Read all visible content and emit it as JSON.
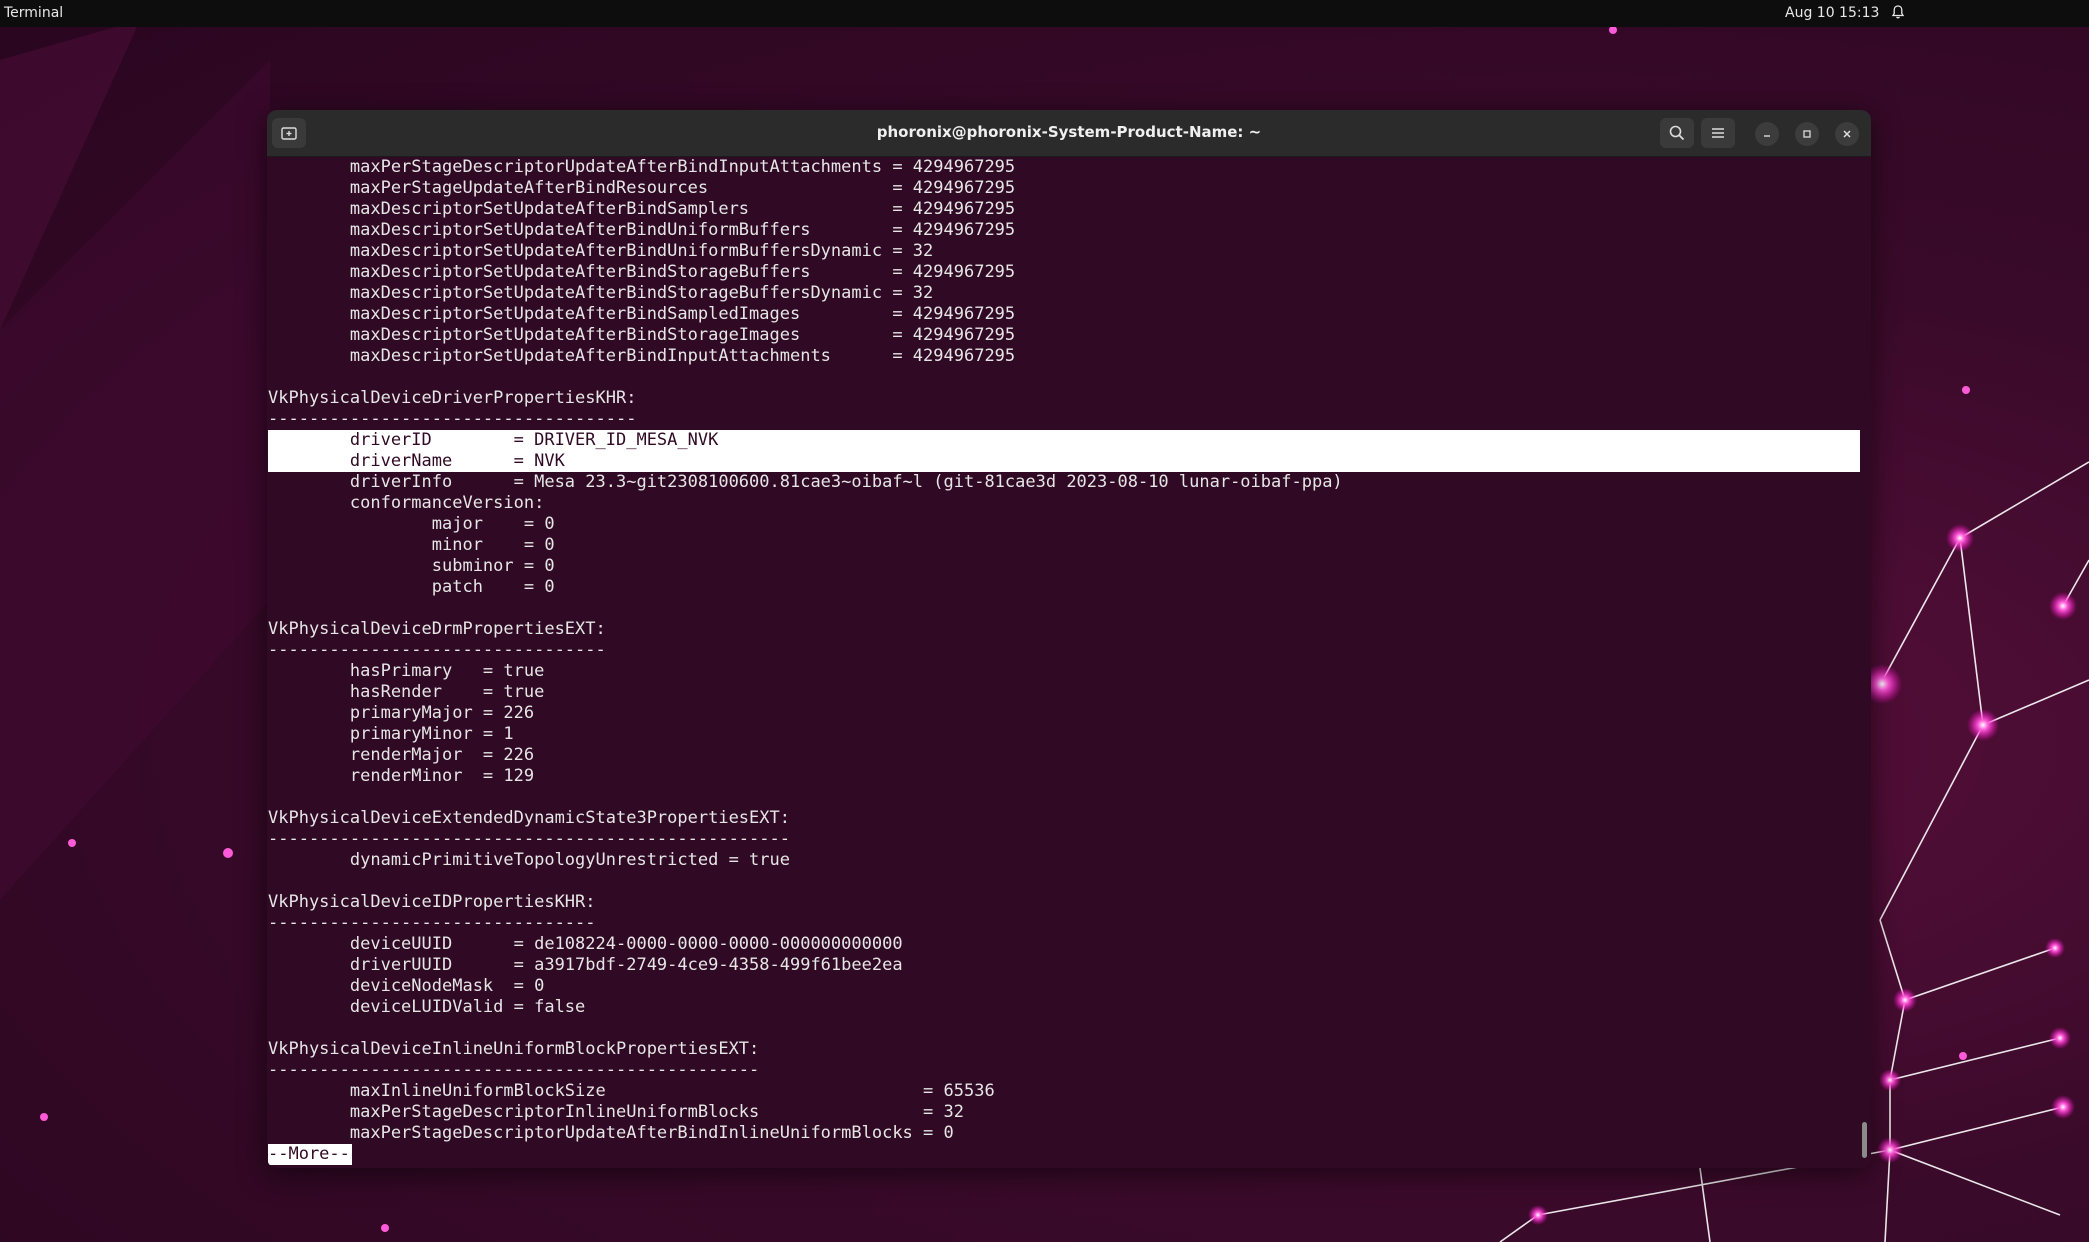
{
  "topbar": {
    "app_name": "Terminal",
    "datetime": "Aug 10  15:13",
    "bell_icon": "notification-bell-icon"
  },
  "window": {
    "title": "phoronix@phoronix-System-Product-Name: ~",
    "buttons": {
      "new_tab": "new-tab-icon",
      "search": "search-icon",
      "menu": "hamburger-menu-icon",
      "minimize": "minimize-icon",
      "maximize": "maximize-icon",
      "close": "close-icon"
    }
  },
  "terminal": {
    "lines": [
      "        maxPerStageDescriptorUpdateAfterBindInputAttachments = 4294967295",
      "        maxPerStageUpdateAfterBindResources                  = 4294967295",
      "        maxDescriptorSetUpdateAfterBindSamplers              = 4294967295",
      "        maxDescriptorSetUpdateAfterBindUniformBuffers        = 4294967295",
      "        maxDescriptorSetUpdateAfterBindUniformBuffersDynamic = 32",
      "        maxDescriptorSetUpdateAfterBindStorageBuffers        = 4294967295",
      "        maxDescriptorSetUpdateAfterBindStorageBuffersDynamic = 32",
      "        maxDescriptorSetUpdateAfterBindSampledImages         = 4294967295",
      "        maxDescriptorSetUpdateAfterBindStorageImages         = 4294967295",
      "        maxDescriptorSetUpdateAfterBindInputAttachments      = 4294967295",
      "",
      "VkPhysicalDeviceDriverPropertiesKHR:",
      "------------------------------------",
      "        driverID        = DRIVER_ID_MESA_NVK",
      "        driverName      = NVK",
      "        driverInfo      = Mesa 23.3~git2308100600.81cae3~oibaf~l (git-81cae3d 2023-08-10 lunar-oibaf-ppa)",
      "        conformanceVersion:",
      "                major    = 0",
      "                minor    = 0",
      "                subminor = 0",
      "                patch    = 0",
      "",
      "VkPhysicalDeviceDrmPropertiesEXT:",
      "---------------------------------",
      "        hasPrimary   = true",
      "        hasRender    = true",
      "        primaryMajor = 226",
      "        primaryMinor = 1",
      "        renderMajor  = 226",
      "        renderMinor  = 129",
      "",
      "VkPhysicalDeviceExtendedDynamicState3PropertiesEXT:",
      "---------------------------------------------------",
      "        dynamicPrimitiveTopologyUnrestricted = true",
      "",
      "VkPhysicalDeviceIDPropertiesKHR:",
      "--------------------------------",
      "        deviceUUID      = de108224-0000-0000-0000-000000000000",
      "        driverUUID      = a3917bdf-2749-4ce9-4358-499f61bee2ea",
      "        deviceNodeMask  = 0",
      "        deviceLUIDValid = false",
      "",
      "VkPhysicalDeviceInlineUniformBlockPropertiesEXT:",
      "------------------------------------------------",
      "        maxInlineUniformBlockSize                               = 65536",
      "        maxPerStageDescriptorInlineUniformBlocks                = 32",
      "        maxPerStageDescriptorUpdateAfterBindInlineUniformBlocks = 0"
    ],
    "highlighted_lines": [
      13,
      14
    ],
    "pager_prompt": "--More--"
  },
  "colors": {
    "terminal_bg": "#300a24",
    "text": "#e6e6e6",
    "highlight_bg": "#ffffff",
    "headerbar": "#2b2b2b",
    "accent_pink": "#ff3bd0"
  }
}
